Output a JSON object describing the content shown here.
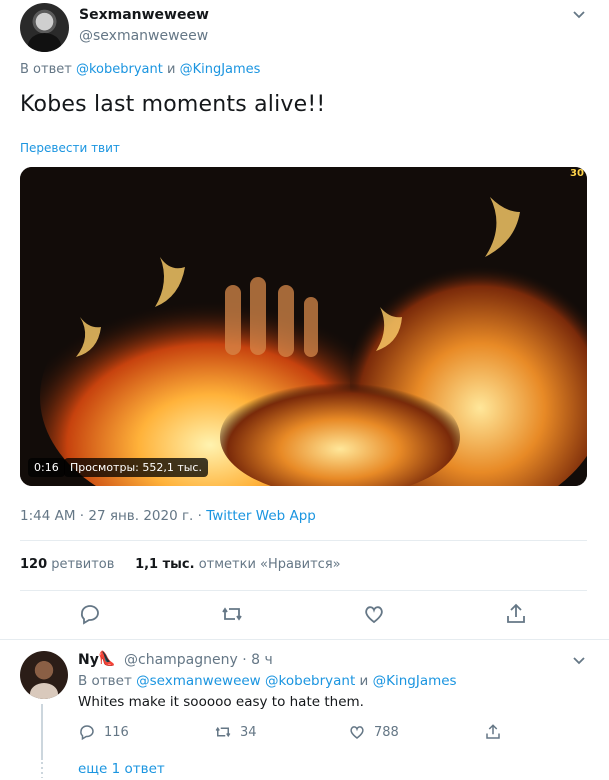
{
  "tweet": {
    "display_name": "Sexmanweweew",
    "handle": "@sexmanweweew",
    "reply_prefix": "В ответ",
    "reply_user1": "@kobebryant",
    "reply_and": "и",
    "reply_user2": "@KingJames",
    "text": "Kobes last moments alive!!",
    "translate_label": "Перевести твит",
    "video": {
      "duration": "0:16",
      "views": "Просмотры: 552,1 тыс.",
      "corner_badge": "30"
    },
    "time": "1:44 AM · 27 янв. 2020 г. · ",
    "app": "Twitter Web App",
    "retweets_count": "120",
    "retweets_label": "ретвитов",
    "likes_count": "1,1 тыс.",
    "likes_label": "отметки «Нравится»",
    "icons": [
      "reply-icon",
      "retweet-icon",
      "like-icon",
      "share-icon",
      "caret-down-icon"
    ]
  },
  "reply": {
    "display_name": "Ny",
    "emoji": "👠",
    "handle": "@champagneny · 8 ч",
    "reply_prefix": "В ответ",
    "reply_user1": "@sexmanweweew",
    "reply_user2": "@kobebryant",
    "reply_and": "и",
    "reply_user3": "@KingJames",
    "text": "Whites make it sooooo easy to hate them.",
    "reply_count": "116",
    "retweet_count": "34",
    "like_count": "788",
    "more_label": "еще 1 ответ"
  },
  "colors": {
    "accent": "#1b95e0",
    "muted": "#657786",
    "text": "#14171a",
    "divider": "#e6ecf0"
  }
}
